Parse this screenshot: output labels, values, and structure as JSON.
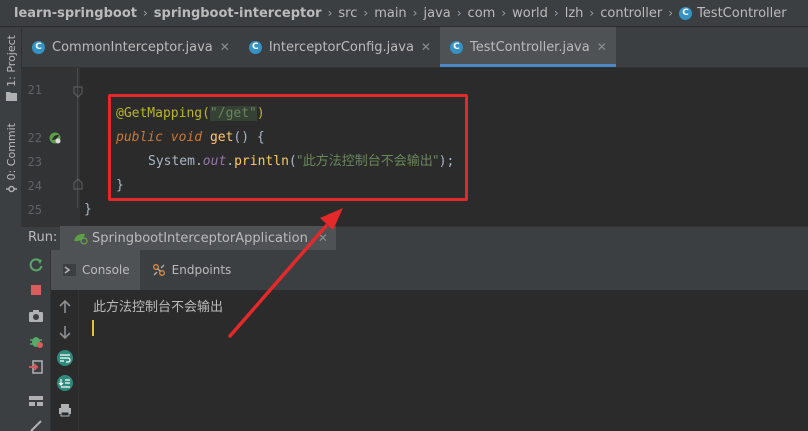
{
  "breadcrumb": [
    {
      "label": "learn-springboot",
      "bold": true
    },
    {
      "label": "springboot-interceptor",
      "bold": true
    },
    {
      "label": "src"
    },
    {
      "label": "main"
    },
    {
      "label": "java"
    },
    {
      "label": "com"
    },
    {
      "label": "world"
    },
    {
      "label": "lzh"
    },
    {
      "label": "controller"
    },
    {
      "label": "TestController",
      "icon": "class-icon"
    }
  ],
  "class_icon_letter": "C",
  "left_strip": {
    "project_label": "1: Project",
    "commit_label": "0: Commit"
  },
  "tabs": [
    {
      "label": "CommonInterceptor.java",
      "close": "✕",
      "active": false
    },
    {
      "label": "InterceptorConfig.java",
      "close": "✕",
      "active": false
    },
    {
      "label": "TestController.java",
      "close": "✕",
      "active": true
    }
  ],
  "editor": {
    "line_numbers": [
      "21",
      "22",
      "23",
      "24",
      "25"
    ],
    "code": {
      "l1_anno": "@GetMapping(",
      "l1_str": "\"/get\"",
      "l1_close": ")",
      "l2_kw1": "public",
      "l2_kw2": "void",
      "l2_fn": "get",
      "l2_rest": "() {",
      "l3_cls": "System.",
      "l3_fld": "out",
      "l3_dot": ".",
      "l3_fn": "println",
      "l3_open": "(",
      "l3_str": "\"此方法控制台不会输出\"",
      "l3_close": ");",
      "l4": "}",
      "l5": "}"
    }
  },
  "run": {
    "label": "Run:",
    "config_name": "SpringbootInterceptorApplication",
    "close": "✕"
  },
  "console": {
    "tabs": [
      {
        "label": "Console",
        "active": true
      },
      {
        "label": "Endpoints",
        "active": false
      }
    ],
    "output": "此方法控制台不会输出"
  },
  "colors": {
    "annotation_box": "#e5292b",
    "arrow": "#e5292b",
    "active_tab_underline": "#4a88c7"
  }
}
